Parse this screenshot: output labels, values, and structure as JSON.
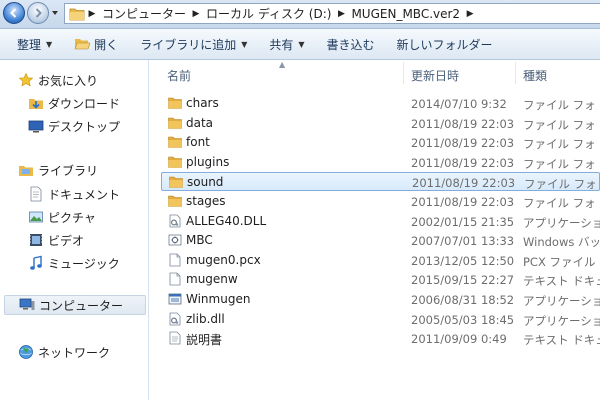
{
  "address": {
    "crumbs": [
      "コンピューター",
      "ローカル ディスク (D:)",
      "MUGEN_MBC.ver2"
    ]
  },
  "command_bar": {
    "organize": "整理",
    "open": "開く",
    "add_to_library": "ライブラリに追加",
    "share": "共有",
    "burn": "書き込む",
    "new_folder": "新しいフォルダー"
  },
  "nav": {
    "favorites": "お気に入り",
    "downloads": "ダウンロード",
    "desktop": "デスクトップ",
    "libraries": "ライブラリ",
    "documents": "ドキュメント",
    "pictures": "ピクチャ",
    "videos": "ビデオ",
    "music": "ミュージック",
    "computer": "コンピューター",
    "network": "ネットワーク"
  },
  "columns": {
    "name": "名前",
    "date": "更新日時",
    "type": "種類"
  },
  "files": [
    {
      "name": "chars",
      "date": "2014/07/10 9:32",
      "type": "ファイル フォ",
      "icon": "folder-icon"
    },
    {
      "name": "data",
      "date": "2011/08/19 22:03",
      "type": "ファイル フォ",
      "icon": "folder-icon"
    },
    {
      "name": "font",
      "date": "2011/08/19 22:03",
      "type": "ファイル フォ",
      "icon": "folder-icon"
    },
    {
      "name": "plugins",
      "date": "2011/08/19 22:03",
      "type": "ファイル フォ",
      "icon": "folder-icon"
    },
    {
      "name": "sound",
      "date": "2011/08/19 22:03",
      "type": "ファイル フォ",
      "icon": "folder-icon"
    },
    {
      "name": "stages",
      "date": "2011/08/19 22:03",
      "type": "ファイル フォ",
      "icon": "folder-icon"
    },
    {
      "name": "ALLEG40.DLL",
      "date": "2002/01/15 21:35",
      "type": "アプリケーショ",
      "icon": "dll-icon"
    },
    {
      "name": "MBC",
      "date": "2007/07/01 13:33",
      "type": "Windows バッチ",
      "icon": "batch-icon"
    },
    {
      "name": "mugen0.pcx",
      "date": "2013/12/05 12:50",
      "type": "PCX ファイル",
      "icon": "file-icon"
    },
    {
      "name": "mugenw",
      "date": "2015/09/15 22:27",
      "type": "テキスト ドキュ",
      "icon": "file-icon"
    },
    {
      "name": "Winmugen",
      "date": "2006/08/31 18:52",
      "type": "アプリケーショ",
      "icon": "exe-icon"
    },
    {
      "name": "zlib.dll",
      "date": "2005/05/03 18:45",
      "type": "アプリケーショ",
      "icon": "dll-icon"
    },
    {
      "name": "説明書",
      "date": "2011/09/09 0:49",
      "type": "テキスト ドキュ",
      "icon": "text-file-icon"
    }
  ],
  "selected_file": "sound",
  "colors": {
    "folder": "#f2c55c",
    "selection_border": "#84acdd",
    "header_text": "#4c607a",
    "command_text": "#1e395b"
  }
}
